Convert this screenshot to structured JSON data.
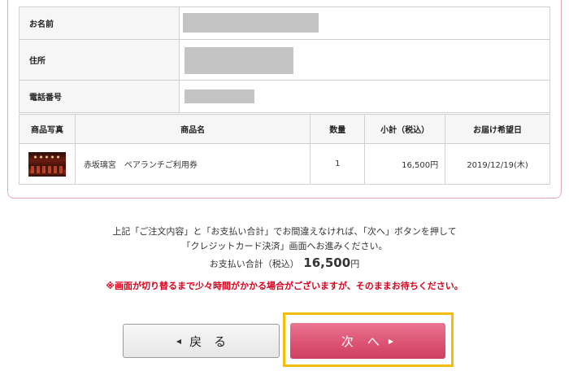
{
  "customer": {
    "name_label": "お名前",
    "address_label": "住所",
    "phone_label": "電話番号"
  },
  "items_table": {
    "headers": [
      "商品写真",
      "商品名",
      "数量",
      "小計（税込）",
      "お届け希望日"
    ],
    "rows": [
      {
        "name": "赤坂璃宮　ペアランチご利用券",
        "quantity": "1",
        "subtotal": "16,500円",
        "delivery_date": "2019/12/19(木)"
      }
    ]
  },
  "message": {
    "line1": "上記「ご注文内容」と「お支払い合計」でお間違えなければ、「次へ」ボタンを押して",
    "line2": "「クレジットカード決済」画面へお進みください。"
  },
  "total": {
    "label": "お支払い合計（税込）",
    "amount": "16,500",
    "unit": "円"
  },
  "warning": "※画面が切り替るまで少々時間がかかる場合がございますが、そのままお待ちください。",
  "buttons": {
    "back_label": "戻　る",
    "next_label": "次　へ"
  },
  "icons": {
    "back_arrow": "left-triangle-icon",
    "next_arrow": "right-triangle-icon"
  },
  "colors": {
    "accent_pink": "#dc5474",
    "highlight_yellow": "#f5bd0b",
    "warning_red": "#d8001b"
  }
}
